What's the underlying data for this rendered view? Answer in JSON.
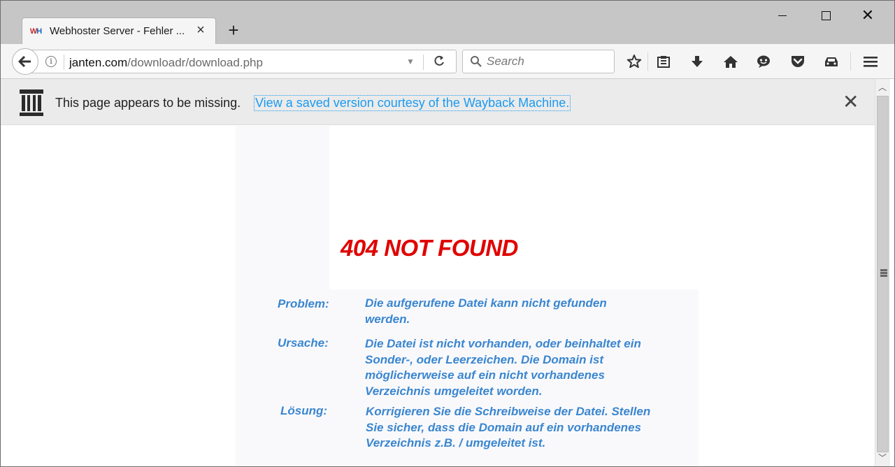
{
  "browser": {
    "tab": {
      "title": "Webhoster Server - Fehler ..."
    },
    "address": {
      "host": "janten.com",
      "path": "/downloadr/download.php"
    },
    "search": {
      "placeholder": "Search"
    }
  },
  "notification": {
    "message": "This page appears to be missing.",
    "link": "View a saved version courtesy of the Wayback Machine."
  },
  "page": {
    "title": "404 NOT FOUND",
    "rows": [
      {
        "label": "Problem:",
        "text": "Die aufgerufene Datei kann nicht gefunden werden."
      },
      {
        "label": "Ursache:",
        "text": "Die Datei ist nicht vorhanden, oder beinhaltet ein Sonder-, oder Leerzeichen. Die Domain ist möglicherweise auf ein nicht vorhandenes Verzeichnis umgeleitet worden."
      },
      {
        "label": "Lösung:",
        "text": "Korrigieren Sie die Schreibweise der Datei. Stellen Sie sicher, dass die Domain auf ein vorhandenes Verzeichnis z.B. / umgeleitet ist."
      }
    ]
  },
  "colors": {
    "error_red": "#e00000",
    "text_blue": "#3a86cf",
    "link_blue": "#1b9af0"
  }
}
